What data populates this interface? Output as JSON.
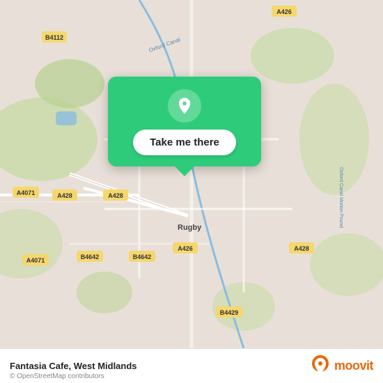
{
  "map": {
    "background_color": "#e8e0d8",
    "center_lat": 52.37,
    "center_lon": -1.26
  },
  "popup": {
    "button_label": "Take me there",
    "background_color": "#2ecc7a"
  },
  "bottom_bar": {
    "place_name": "Fantasia Cafe, West Midlands",
    "copyright": "© OpenStreetMap contributors",
    "moovit_label": "moovit"
  },
  "road_labels": [
    "A426",
    "B4112",
    "A4071",
    "A428",
    "A428",
    "B4642",
    "B4642",
    "A426",
    "B4429",
    "A428",
    "Oxford Canal",
    "Rugby",
    "Oxford Canal Morton Pound"
  ]
}
